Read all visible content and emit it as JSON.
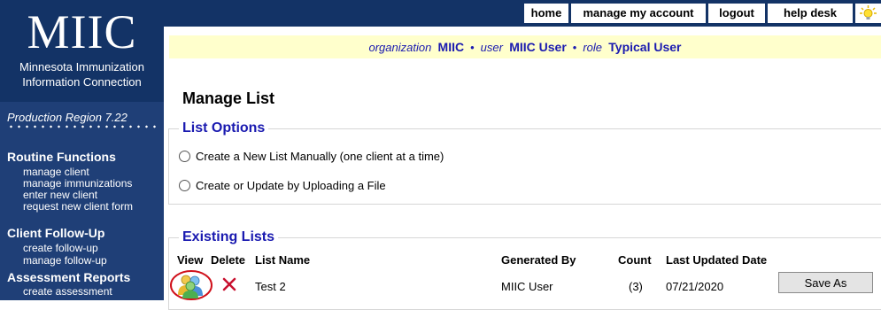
{
  "sidebar": {
    "logo_big": "MIIC",
    "logo_line1": "Minnesota Immunization",
    "logo_line2": "Information Connection",
    "region": "Production Region 7.22",
    "sections": [
      {
        "title": "Routine Functions",
        "items": [
          "manage client",
          "manage immunizations",
          "enter new client",
          "request new client form"
        ]
      },
      {
        "title": "Client Follow-Up",
        "items": [
          "create follow-up",
          "manage follow-up"
        ]
      },
      {
        "title": "Assessment Reports",
        "items": [
          "create assessment"
        ]
      }
    ]
  },
  "topnav": {
    "home": "home",
    "manage_account": "manage my account",
    "logout": "logout",
    "help_desk": "help desk",
    "tip_icon": "lightbulb-icon"
  },
  "orgbar": {
    "org_label": "organization",
    "org_value": "MIIC",
    "user_label": "user",
    "user_value": "MIIC User",
    "role_label": "role",
    "role_value": "Typical User",
    "separator": "•"
  },
  "main": {
    "title": "Manage List",
    "list_options": {
      "legend": "List Options",
      "option_manual": "Create a New List Manually (one client at a time)",
      "option_upload": "Create or Update by Uploading a File"
    },
    "existing_lists": {
      "legend": "Existing Lists",
      "columns": {
        "view": "View",
        "delete": "Delete",
        "list_name": "List Name",
        "generated_by": "Generated By",
        "count": "Count",
        "last_updated": "Last Updated Date"
      },
      "rows": [
        {
          "list_name": "Test 2",
          "generated_by": "MIIC User",
          "count": "(3)",
          "last_updated": "07/21/2020",
          "action": "Save As"
        }
      ]
    }
  },
  "colors": {
    "nav_dark": "#133366",
    "sidebar": "#1f3f77",
    "accent_blue": "#1a1ab0",
    "org_bar_bg": "#ffffcc",
    "highlight_red": "#d0101a"
  }
}
